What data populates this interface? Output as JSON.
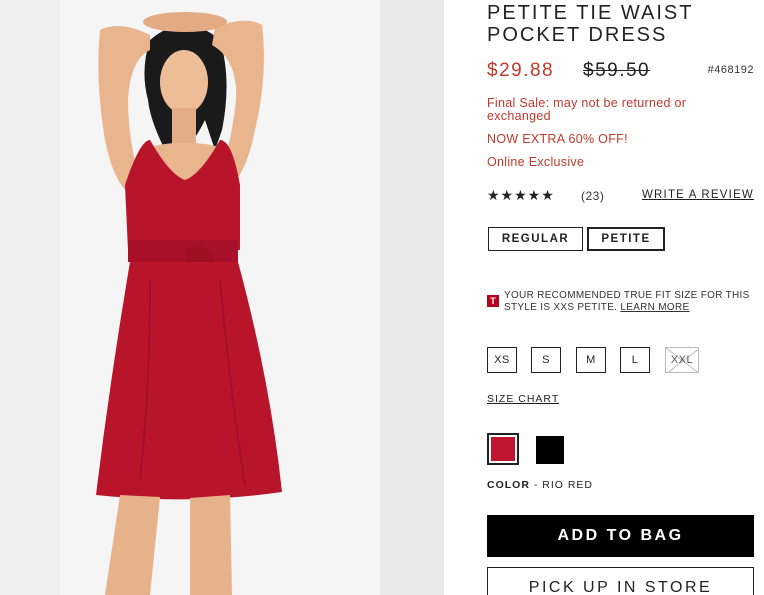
{
  "product": {
    "title": "PETITE TIE WAIST POCKET DRESS",
    "sale_price": "$29.88",
    "original_price": "$59.50",
    "sku": "#468192",
    "final_sale_note": "Final Sale: may not be returned or exchanged",
    "promo_extra": "NOW EXTRA 60% OFF!",
    "online_exclusive": "Online Exclusive",
    "image_alt": "model-wearing-red-dress"
  },
  "reviews": {
    "stars": "★★★★★",
    "rating_value": 5,
    "count": "(23)",
    "write_label": "WRITE A REVIEW"
  },
  "fit_options": {
    "regular": "REGULAR",
    "petite": "PETITE",
    "selected": "PETITE"
  },
  "fit_recommendation": {
    "badge": "T",
    "text": "YOUR RECOMMENDED TRUE FIT SIZE FOR THIS STYLE IS XXS PETITE.",
    "learn_more": "LEARN MORE"
  },
  "sizes": {
    "xs": "XS",
    "s": "S",
    "m": "M",
    "l": "L",
    "xxl": "XXL",
    "unavailable": [
      "XXL"
    ]
  },
  "size_chart_label": "SIZE CHART",
  "colors": {
    "options": [
      {
        "name": "RIO RED",
        "hex": "#c0152f",
        "selected": true
      },
      {
        "name": "BLACK",
        "hex": "#000000",
        "selected": false
      }
    ],
    "label": "COLOR",
    "separator": " - ",
    "selected_name": "RIO RED"
  },
  "actions": {
    "add_to_bag": "ADD TO BAG",
    "pick_up": "PICK UP IN STORE"
  },
  "theme": {
    "sale_color": "#c0392b",
    "dress_color": "#b8142a"
  }
}
